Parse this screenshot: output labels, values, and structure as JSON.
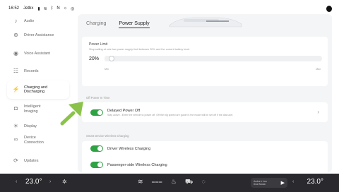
{
  "status": {
    "time": "16:52",
    "carrier": "Jetbx",
    "indicators": [
      "sig",
      "wifi",
      "bt",
      "n",
      "sun",
      "gps"
    ]
  },
  "sidebar": {
    "items": [
      {
        "label": "Audio",
        "icon": "speaker-icon"
      },
      {
        "label": "Driver Assistance",
        "icon": "steering-icon"
      },
      {
        "label": "Voice Assistant",
        "icon": "voice-icon"
      },
      {
        "label": "Records",
        "icon": "records-icon"
      },
      {
        "label": "Charging and Discharging",
        "icon": "plug-icon",
        "active": true
      },
      {
        "label": "Intelligent Imaging",
        "icon": "camera-icon"
      },
      {
        "label": "Display",
        "icon": "sun-icon"
      },
      {
        "label": "Device Connection",
        "icon": "link-icon"
      },
      {
        "label": "Updates",
        "icon": "update-icon"
      }
    ]
  },
  "tabs": {
    "charging": "Charging",
    "power_supply": "Power Supply",
    "active": "power_supply"
  },
  "power_limit": {
    "title": "Power Limit",
    "desc": "Stop sailing at sole low power supply limit between 20% and the current battery level.",
    "value": "20%",
    "min_label": "Min",
    "max_label": "Max",
    "level": 0.02
  },
  "delayed_section": {
    "title": "Off Power In Time",
    "toggle_title": "Delayed Power Off",
    "toggle_desc": "Stay active - Enter the vehicle to power off. Off the big speed are guide in the mode will be set off if the dial user.",
    "enabled": true
  },
  "wireless_section": {
    "title": "Smart Device Wireless Charging",
    "driver_label": "Driver Wireless Charging",
    "passenger_label": "Passenger-side Wireless Charging",
    "driver_enabled": true,
    "passenger_enabled": true
  },
  "bottom": {
    "temp_left": "23.0",
    "temp_right": "23.0",
    "media_title": "Andra Ir Iwo",
    "media_sub": "Ibrat Music"
  },
  "colors": {
    "accent_green": "#2fa244",
    "arrow_green": "#8bc34a",
    "bottom_bar": "#2a2a2e"
  }
}
